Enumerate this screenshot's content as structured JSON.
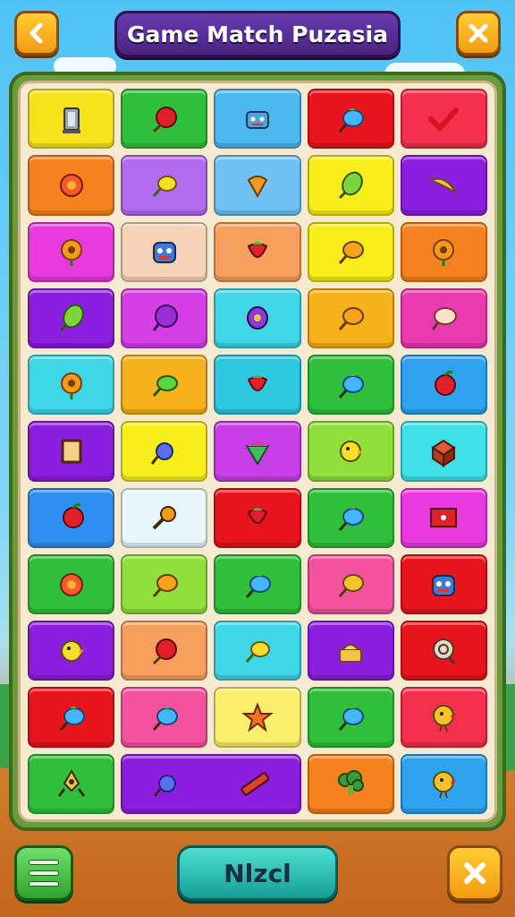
{
  "header": {
    "title": "Game Match Puzasia",
    "back_icon": "chevron-left-icon",
    "close_icon": "close-icon"
  },
  "footer": {
    "menu_icon": "menu-icon",
    "next_label": "Nlzcl",
    "close_icon": "close-icon"
  },
  "colors": {
    "title_plate": "#4a2480",
    "board_frame": "#6b9c3c",
    "board": "#f5ead0",
    "accent_orange": "#f29b12",
    "next_button": "#139e96"
  },
  "grid": {
    "rows": 11,
    "cols": 5,
    "tiles": [
      {
        "row": 0,
        "col": 0,
        "span": 1,
        "color": "#f7e21b",
        "icon": "lantern-icon"
      },
      {
        "row": 0,
        "col": 1,
        "span": 1,
        "color": "#2fbf3a",
        "icon": "cherry-icon"
      },
      {
        "row": 0,
        "col": 2,
        "span": 1,
        "color": "#4bb8f0",
        "icon": "robot-icon"
      },
      {
        "row": 0,
        "col": 3,
        "span": 1,
        "color": "#e8141e",
        "icon": "blueberry-icon"
      },
      {
        "row": 0,
        "col": 4,
        "span": 1,
        "color": "#f4304e",
        "icon": "heart-icon"
      },
      {
        "row": 1,
        "col": 0,
        "span": 1,
        "color": "#f5821f",
        "icon": "flower-icon"
      },
      {
        "row": 1,
        "col": 1,
        "span": 1,
        "color": "#b36bf0",
        "icon": "lemon-icon"
      },
      {
        "row": 1,
        "col": 2,
        "span": 1,
        "color": "#6ec1f2",
        "icon": "carrot-icon"
      },
      {
        "row": 1,
        "col": 3,
        "span": 1,
        "color": "#f7ee1b",
        "icon": "leaf-icon"
      },
      {
        "row": 1,
        "col": 4,
        "span": 1,
        "color": "#8c1ee0",
        "icon": "banana-icon"
      },
      {
        "row": 2,
        "col": 0,
        "span": 1,
        "color": "#e83adf",
        "icon": "sunflower-icon"
      },
      {
        "row": 2,
        "col": 1,
        "span": 1,
        "color": "#f6d2b8",
        "icon": "monster-icon"
      },
      {
        "row": 2,
        "col": 2,
        "span": 1,
        "color": "#f7a05e",
        "icon": "strawberry-icon"
      },
      {
        "row": 2,
        "col": 3,
        "span": 1,
        "color": "#f7ee1b",
        "icon": "orange-icon"
      },
      {
        "row": 2,
        "col": 4,
        "span": 1,
        "color": "#f5821f",
        "icon": "sunflower-icon"
      },
      {
        "row": 3,
        "col": 0,
        "span": 1,
        "color": "#8c1ee0",
        "icon": "leaf-icon"
      },
      {
        "row": 3,
        "col": 1,
        "span": 1,
        "color": "#d63ee6",
        "icon": "grape-icon"
      },
      {
        "row": 3,
        "col": 2,
        "span": 1,
        "color": "#3fd6e8",
        "icon": "plum-icon"
      },
      {
        "row": 3,
        "col": 3,
        "span": 1,
        "color": "#f7b21b",
        "icon": "orange-icon"
      },
      {
        "row": 3,
        "col": 4,
        "span": 1,
        "color": "#ea3ab0",
        "icon": "peach-icon"
      },
      {
        "row": 4,
        "col": 0,
        "span": 1,
        "color": "#3fd6e8",
        "icon": "sunflower-icon"
      },
      {
        "row": 4,
        "col": 1,
        "span": 1,
        "color": "#f7b21b",
        "icon": "lime-icon"
      },
      {
        "row": 4,
        "col": 2,
        "span": 1,
        "color": "#2ec7e0",
        "icon": "strawberry-icon"
      },
      {
        "row": 4,
        "col": 3,
        "span": 1,
        "color": "#2fbf3a",
        "icon": "blueberry-icon"
      },
      {
        "row": 4,
        "col": 4,
        "span": 1,
        "color": "#2fa2f0",
        "icon": "apple-icon"
      },
      {
        "row": 5,
        "col": 0,
        "span": 1,
        "color": "#8c1ee0",
        "icon": "frame-icon"
      },
      {
        "row": 5,
        "col": 1,
        "span": 1,
        "color": "#f7ee1b",
        "icon": "candy-icon"
      },
      {
        "row": 5,
        "col": 2,
        "span": 1,
        "color": "#c93ee6",
        "icon": "gem-icon"
      },
      {
        "row": 5,
        "col": 3,
        "span": 1,
        "color": "#8fe03a",
        "icon": "bird-icon"
      },
      {
        "row": 5,
        "col": 4,
        "span": 1,
        "color": "#3fe0e8",
        "icon": "cube-icon"
      },
      {
        "row": 6,
        "col": 0,
        "span": 1,
        "color": "#2f8ff0",
        "icon": "apple-icon"
      },
      {
        "row": 6,
        "col": 1,
        "span": 1,
        "color": "#e6f6fb",
        "icon": "key-icon"
      },
      {
        "row": 6,
        "col": 2,
        "span": 1,
        "color": "#e8141e",
        "icon": "strawberry-icon"
      },
      {
        "row": 6,
        "col": 3,
        "span": 1,
        "color": "#2fbf3a",
        "icon": "blueberry-icon"
      },
      {
        "row": 6,
        "col": 4,
        "span": 1,
        "color": "#e83adf",
        "icon": "sign-icon"
      },
      {
        "row": 7,
        "col": 0,
        "span": 1,
        "color": "#2fbf3a",
        "icon": "flower-icon"
      },
      {
        "row": 7,
        "col": 1,
        "span": 1,
        "color": "#8fe03a",
        "icon": "orange-icon"
      },
      {
        "row": 7,
        "col": 2,
        "span": 1,
        "color": "#2fbf3a",
        "icon": "blueberry-icon"
      },
      {
        "row": 7,
        "col": 3,
        "span": 1,
        "color": "#f4529e",
        "icon": "mango-icon"
      },
      {
        "row": 7,
        "col": 4,
        "span": 1,
        "color": "#e8141e",
        "icon": "monster-icon"
      },
      {
        "row": 8,
        "col": 0,
        "span": 1,
        "color": "#8c1ee0",
        "icon": "bird-icon"
      },
      {
        "row": 8,
        "col": 1,
        "span": 1,
        "color": "#f7a05e",
        "icon": "cherry-icon"
      },
      {
        "row": 8,
        "col": 2,
        "span": 1,
        "color": "#3fd6e8",
        "icon": "lemon-icon"
      },
      {
        "row": 8,
        "col": 3,
        "span": 1,
        "color": "#8c1ee0",
        "icon": "cake-icon"
      },
      {
        "row": 8,
        "col": 4,
        "span": 1,
        "color": "#e8141e",
        "icon": "shield-icon"
      },
      {
        "row": 9,
        "col": 0,
        "span": 1,
        "color": "#e8141e",
        "icon": "blueberry-icon"
      },
      {
        "row": 9,
        "col": 1,
        "span": 1,
        "color": "#f4529e",
        "icon": "blueberry-icon"
      },
      {
        "row": 9,
        "col": 2,
        "span": 1,
        "color": "#faee6a",
        "icon": "star-icon"
      },
      {
        "row": 9,
        "col": 3,
        "span": 1,
        "color": "#2fbf3a",
        "icon": "blueberry-icon"
      },
      {
        "row": 9,
        "col": 4,
        "span": 1,
        "color": "#f4304e",
        "icon": "chick-icon"
      },
      {
        "row": 10,
        "col": 0,
        "span": 1,
        "color": "#2fbf3a",
        "icon": "rocket-icon"
      },
      {
        "row": 10,
        "col": 1,
        "span": 2,
        "color": "#8c1ee0",
        "icon": "candy-icon",
        "icon2": "ruler-icon"
      },
      {
        "row": 10,
        "col": 3,
        "span": 1,
        "color": "#f5821f",
        "icon": "broccoli-icon"
      },
      {
        "row": 10,
        "col": 4,
        "span": 1,
        "color": "#2fa2f0",
        "icon": "chick-icon"
      }
    ]
  }
}
